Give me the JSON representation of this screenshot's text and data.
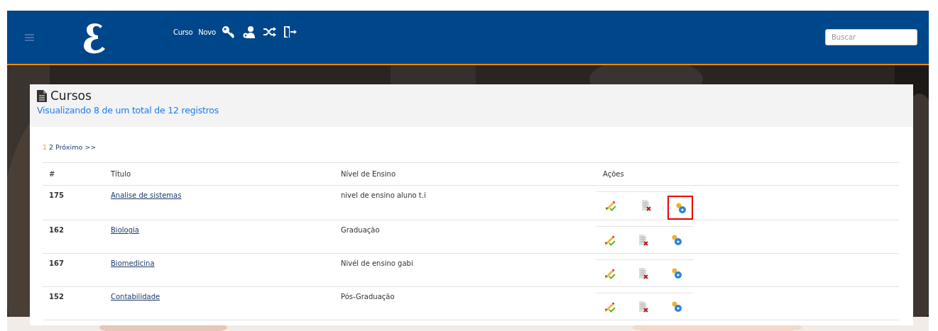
{
  "navbar": {
    "menu": [
      {
        "kind": "text",
        "label": "Curso"
      },
      {
        "kind": "text",
        "label": "Novo"
      },
      {
        "kind": "key"
      },
      {
        "kind": "users"
      },
      {
        "kind": "shuffle"
      },
      {
        "kind": "exit"
      }
    ],
    "search": {
      "placeholder": "Buscar"
    }
  },
  "card": {
    "title": "Cursos",
    "subtitle": "Visualizando 8 de um total de 12 registros",
    "pagination": [
      {
        "label": "1",
        "selected": true
      },
      {
        "label": "2",
        "selected": false
      },
      {
        "label": "Próximo >>",
        "selected": false
      }
    ],
    "table": {
      "columns": [
        "#",
        "Título",
        "Nível de Ensino",
        "Ações"
      ],
      "rows": [
        {
          "id": "175",
          "title": "Analise de sistemas",
          "level_name": "nivel de ensino aluno t.i",
          "actions": [
            {
              "kind": "edit",
              "highlighted": false
            },
            {
              "kind": "delete",
              "highlighted": false
            },
            {
              "kind": "link",
              "highlighted": true
            }
          ]
        },
        {
          "id": "162",
          "title": "Biologia",
          "level_name": "Graduação",
          "actions": [
            {
              "kind": "edit",
              "highlighted": false
            },
            {
              "kind": "delete",
              "highlighted": false
            },
            {
              "kind": "link",
              "highlighted": false
            }
          ]
        },
        {
          "id": "167",
          "title": "Biomedicina",
          "level_name": "Nivél de ensino gabi",
          "actions": [
            {
              "kind": "edit",
              "highlighted": false
            },
            {
              "kind": "delete",
              "highlighted": false
            },
            {
              "kind": "link",
              "highlighted": false
            }
          ]
        },
        {
          "id": "152",
          "title": "Contabilidade",
          "level_name": "Pós-Graduação",
          "actions": [
            {
              "kind": "edit",
              "highlighted": false
            },
            {
              "kind": "delete",
              "highlighted": false
            },
            {
              "kind": "link",
              "highlighted": false
            }
          ]
        }
      ]
    }
  }
}
